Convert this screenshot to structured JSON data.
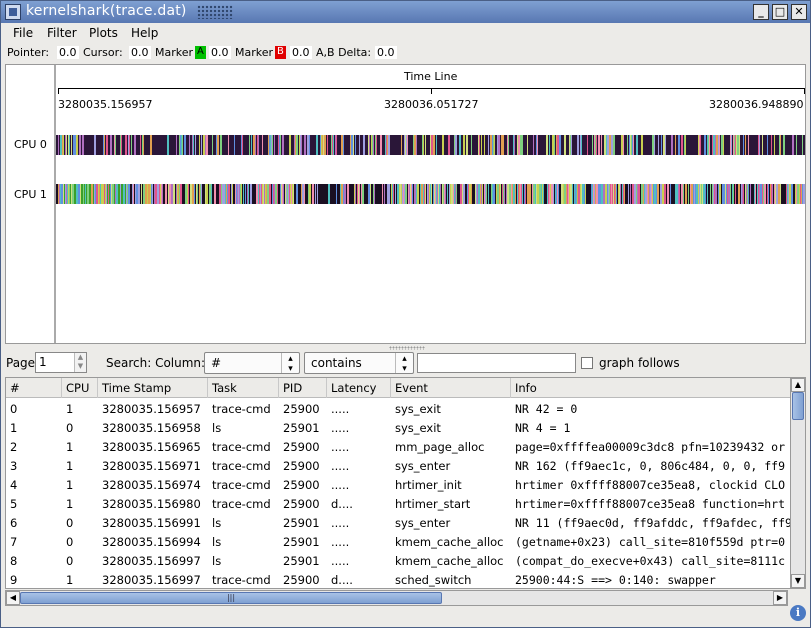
{
  "window": {
    "title": "kernelshark(trace.dat)"
  },
  "menu": [
    "File",
    "Filter",
    "Plots",
    "Help"
  ],
  "infobar": {
    "pointer_label": "Pointer:",
    "pointer_value": "0.0",
    "cursor_label": "Cursor:",
    "cursor_value": "0.0",
    "markerA_label": "Marker",
    "markerA_tag": "A",
    "markerA_value": "0.0",
    "markerA_color": "#00c000",
    "markerB_label": "Marker",
    "markerB_tag": "B",
    "markerB_value": "0.0",
    "markerB_color": "#e00000",
    "delta_label": "A,B Delta:",
    "delta_value": "0.0"
  },
  "graph": {
    "timeline_title": "Time Line",
    "ticks": [
      "3280035.156957",
      "3280036.051727",
      "3280036.948890"
    ],
    "cpus": [
      "CPU 0",
      "CPU 1"
    ]
  },
  "search": {
    "page_label": "Page",
    "page_value": "1",
    "search_label": "Search: Column:",
    "column_value": "#",
    "mode_value": "contains",
    "query_value": "",
    "graph_follows_label": "graph follows"
  },
  "table": {
    "columns": [
      "#",
      "CPU",
      "Time Stamp",
      "Task",
      "PID",
      "Latency",
      "Event",
      "Info"
    ],
    "rows": [
      [
        "0",
        "1",
        "3280035.156957",
        "trace-cmd",
        "25900",
        ".....",
        "sys_exit",
        "NR 42 = 0"
      ],
      [
        "1",
        "0",
        "3280035.156958",
        "ls",
        "25901",
        ".....",
        "sys_exit",
        "NR 4 = 1"
      ],
      [
        "2",
        "1",
        "3280035.156965",
        "trace-cmd",
        "25900",
        ".....",
        "mm_page_alloc",
        "page=0xffffea00009c3dc8 pfn=10239432 or"
      ],
      [
        "3",
        "1",
        "3280035.156971",
        "trace-cmd",
        "25900",
        ".....",
        "sys_enter",
        "NR 162 (ff9aec1c, 0, 806c484, 0, 0, ff9"
      ],
      [
        "4",
        "1",
        "3280035.156974",
        "trace-cmd",
        "25900",
        ".....",
        "hrtimer_init",
        "hrtimer 0xffff88007ce35ea8, clockid CLO"
      ],
      [
        "5",
        "1",
        "3280035.156980",
        "trace-cmd",
        "25900",
        "d....",
        "hrtimer_start",
        "hrtimer=0xffff88007ce35ea8 function=hrt"
      ],
      [
        "6",
        "0",
        "3280035.156991",
        "ls",
        "25901",
        ".....",
        "sys_enter",
        "NR 11 (ff9aec0d, ff9afddc, ff9afdec, ff9"
      ],
      [
        "7",
        "0",
        "3280035.156994",
        "ls",
        "25901",
        ".....",
        "kmem_cache_alloc",
        "(getname+0x23) call_site=810f559d ptr=0"
      ],
      [
        "8",
        "0",
        "3280035.156997",
        "ls",
        "25901",
        ".....",
        "kmem_cache_alloc",
        "(compat_do_execve+0x43) call_site=8111c"
      ],
      [
        "9",
        "1",
        "3280035.156997",
        "trace-cmd",
        "25900",
        "d....",
        "sched_switch",
        "25900:44:S ==> 0:140: swapper"
      ]
    ]
  },
  "icons": {
    "app": "kernelshark-icon",
    "minimize": "minimize-icon",
    "maximize": "maximize-icon",
    "close": "close-icon",
    "info": "info-icon",
    "scroll_up": "arrow-up-icon",
    "scroll_down": "arrow-down-icon",
    "scroll_left": "arrow-left-icon",
    "scroll_right": "arrow-right-icon",
    "combo_arrow": "updown-arrow-icon"
  }
}
